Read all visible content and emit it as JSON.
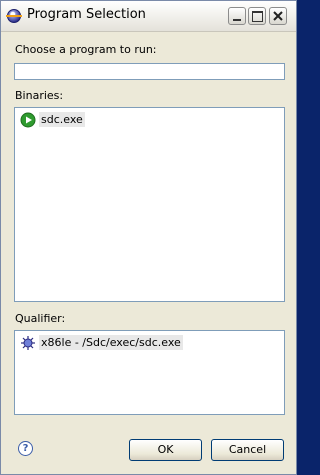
{
  "window": {
    "title": "Program Selection",
    "icon": "eclipse-icon"
  },
  "program_field": {
    "label": "Choose a program to run:",
    "value": "",
    "placeholder": ""
  },
  "binaries": {
    "label": "Binaries:",
    "items": [
      {
        "text": "sdc.exe",
        "icon": "run-arrow-icon",
        "selected": true
      }
    ]
  },
  "qualifier": {
    "label": "Qualifier:",
    "items": [
      {
        "text": "x86le - /Sdc/exec/sdc.exe",
        "icon": "cpu-icon",
        "selected": true
      }
    ]
  },
  "footer": {
    "help_label": "?",
    "ok_label": "OK",
    "cancel_label": "Cancel"
  },
  "colors": {
    "window_bg": "#ece9d8",
    "field_border": "#7f9db9",
    "button_border": "#003c74",
    "selection_bg": "#e8e8e8",
    "run_icon_green": "#2f9b2f"
  }
}
